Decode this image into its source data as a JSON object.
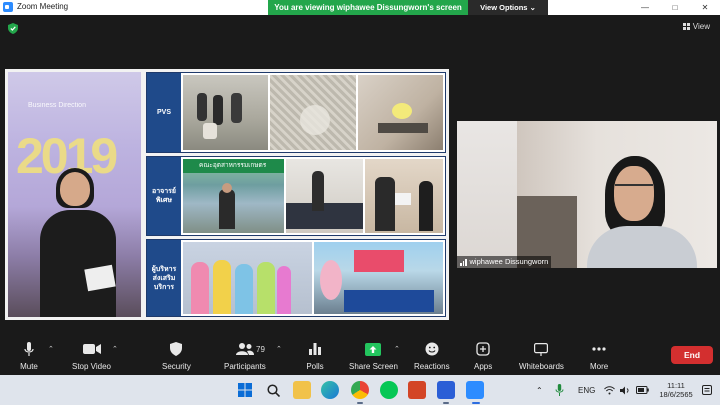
{
  "window": {
    "title": "Zoom Meeting",
    "viewing_banner": "You are viewing wiphawee Dissungworn's screen",
    "view_options": "View Options",
    "view_button": "View",
    "controls": [
      "—",
      "□",
      "✕"
    ]
  },
  "shared_screen": {
    "left_photo": {
      "year": "2019",
      "caption": "Business Direction"
    },
    "panels": [
      {
        "label": "PVS",
        "label_line2": ""
      },
      {
        "label": "อาจารย์",
        "label_line2": "พิเศษ",
        "banner": "คณะอุตสาหกรรมเกษตร"
      },
      {
        "label": "ผู้บริหาร",
        "label_line2": "ส่งเสริมบริการ"
      }
    ]
  },
  "participant_video": {
    "name": "wiphawee Dissungworn"
  },
  "toolbar": {
    "mute": "Mute",
    "stop_video": "Stop Video",
    "security": "Security",
    "participants": "Participants",
    "participants_count": "79",
    "polls": "Polls",
    "share_screen": "Share Screen",
    "reactions": "Reactions",
    "apps": "Apps",
    "whiteboards": "Whiteboards",
    "more": "More",
    "end": "End"
  },
  "taskbar": {
    "language": "ENG",
    "time": "11:11",
    "date": "18/6/2565"
  },
  "colors": {
    "viewing_banner": "#23a64b",
    "end_button": "#d32f2f",
    "share_screen_accent": "#23c55e",
    "panel_label": "#1f4a8a"
  }
}
